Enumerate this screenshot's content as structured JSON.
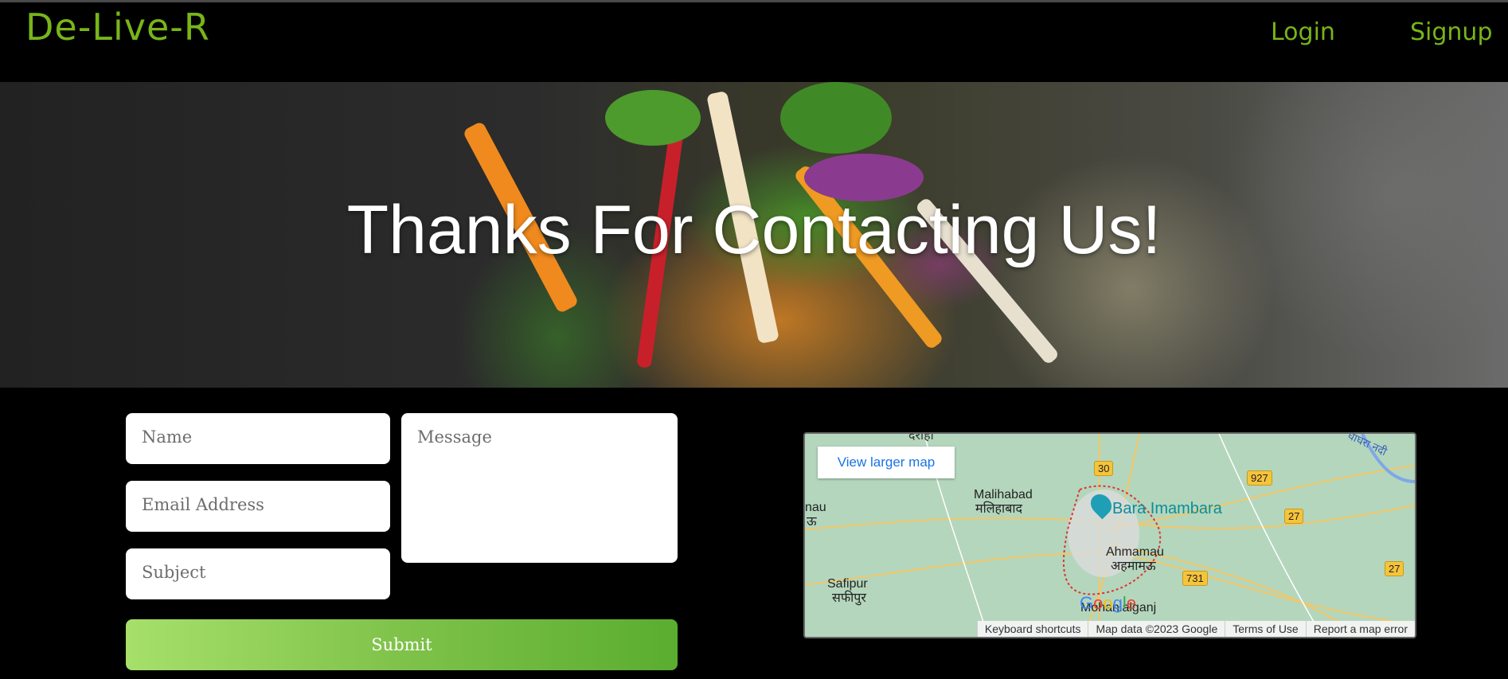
{
  "header": {
    "brand": "De-Live-R",
    "nav": {
      "login": "Login",
      "signup": "Signup"
    }
  },
  "hero": {
    "title": "Thanks For Contacting Us!"
  },
  "form": {
    "name_placeholder": "Name",
    "email_placeholder": "Email Address",
    "subject_placeholder": "Subject",
    "message_placeholder": "Message",
    "submit_label": "Submit"
  },
  "map": {
    "view_larger": "View larger map",
    "labels": {
      "malihabad": "Malihabad",
      "malihabad_hi": "मलिहाबाद",
      "bara_imambara": "Bara Imambara",
      "ahmamau": "Ahmamau",
      "ahmamau_hi": "अहमामऊ",
      "safipur": "Safipur",
      "safipur_hi": "सफीपुर",
      "mohanlalganj": "Mohanlalganj",
      "nau": "nau",
      "u": "ऊ",
      "ghaghra": "घाघरा नदी",
      "top_label": "दराही"
    },
    "shields": [
      "30",
      "927",
      "27",
      "731",
      "27"
    ],
    "google": "Google",
    "footer": {
      "shortcuts": "Keyboard shortcuts",
      "map_data": "Map data ©2023 Google",
      "terms": "Terms of Use",
      "report": "Report a map error"
    }
  }
}
